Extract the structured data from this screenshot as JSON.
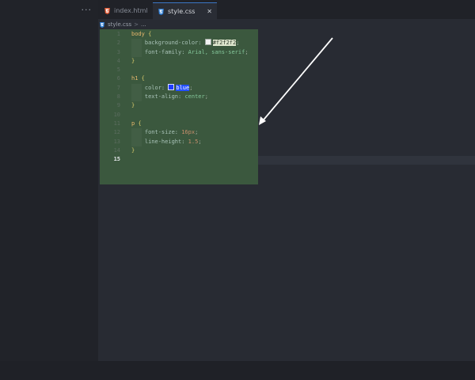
{
  "tabs": [
    {
      "label": "index.html",
      "type": "html",
      "active": false
    },
    {
      "label": "style.css",
      "type": "css",
      "active": true
    }
  ],
  "tab_close": "✕",
  "sidebar": {
    "more_label": "···"
  },
  "breadcrumb": {
    "file": "style.css",
    "separator": ">",
    "rest": "..."
  },
  "code": [
    {
      "n": "1",
      "tokens": [
        {
          "t": "body ",
          "c": "sel"
        },
        {
          "t": "{",
          "c": "brace"
        }
      ]
    },
    {
      "n": "2",
      "tokens": [
        {
          "t": "    "
        },
        {
          "t": "background-color: ",
          "c": "prop"
        },
        {
          "swatch": "light"
        },
        {
          "t": "#f2f2f2",
          "c": "hex"
        },
        {
          "t": ";",
          "c": "punc"
        }
      ]
    },
    {
      "n": "3",
      "tokens": [
        {
          "t": "    "
        },
        {
          "t": "font-family: ",
          "c": "prop"
        },
        {
          "t": "Arial, sans-serif",
          "c": "val"
        },
        {
          "t": ";",
          "c": "punc"
        }
      ]
    },
    {
      "n": "4",
      "tokens": [
        {
          "t": "}",
          "c": "brace"
        }
      ]
    },
    {
      "n": "5",
      "tokens": []
    },
    {
      "n": "6",
      "tokens": [
        {
          "t": "h1 ",
          "c": "sel"
        },
        {
          "t": "{",
          "c": "brace"
        }
      ]
    },
    {
      "n": "7",
      "tokens": [
        {
          "t": "    "
        },
        {
          "t": "color: ",
          "c": "prop"
        },
        {
          "swatch": "blue"
        },
        {
          "t": "blue",
          "c": "blue"
        },
        {
          "t": ";",
          "c": "punc"
        }
      ]
    },
    {
      "n": "8",
      "tokens": [
        {
          "t": "    "
        },
        {
          "t": "text-align: ",
          "c": "prop"
        },
        {
          "t": "center",
          "c": "val"
        },
        {
          "t": ";",
          "c": "punc"
        }
      ]
    },
    {
      "n": "9",
      "tokens": [
        {
          "t": "}",
          "c": "brace"
        }
      ]
    },
    {
      "n": "10",
      "tokens": []
    },
    {
      "n": "11",
      "tokens": [
        {
          "t": "p ",
          "c": "sel"
        },
        {
          "t": "{",
          "c": "brace"
        }
      ]
    },
    {
      "n": "12",
      "tokens": [
        {
          "t": "    "
        },
        {
          "t": "font-size: ",
          "c": "prop"
        },
        {
          "t": "16px",
          "c": "num"
        },
        {
          "t": ";",
          "c": "punc"
        }
      ]
    },
    {
      "n": "13",
      "tokens": [
        {
          "t": "    "
        },
        {
          "t": "line-height: ",
          "c": "prop"
        },
        {
          "t": "1.5",
          "c": "num"
        },
        {
          "t": ";",
          "c": "punc"
        }
      ]
    },
    {
      "n": "14",
      "tokens": [
        {
          "t": "}",
          "c": "brace"
        }
      ]
    },
    {
      "n": "15",
      "tokens": [],
      "active": true
    }
  ],
  "colors": {
    "accent": "#3b76c4",
    "selection": "#3d5c3f",
    "arrow": "#ffffff"
  }
}
